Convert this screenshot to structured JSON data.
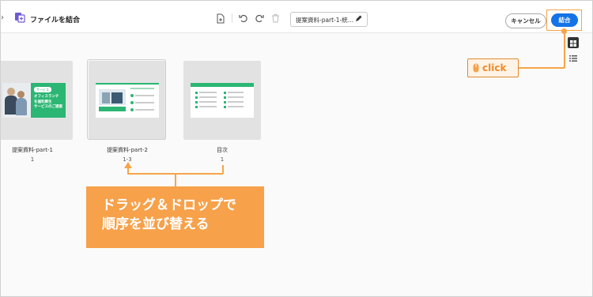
{
  "toolbar": {
    "title": "ファイルを結合",
    "filename": "提案資料-part-1-統…",
    "cancel_label": "キャンセル",
    "combine_label": "結合"
  },
  "icons": {
    "app": "combine-files-icon",
    "add_file": "add-file-icon",
    "undo": "undo-icon",
    "redo": "redo-icon",
    "delete": "delete-icon",
    "edit": "pencil-icon",
    "grid_view": "grid-view-icon",
    "list_view": "list-view-icon",
    "mouse": "mouse-icon"
  },
  "pages": [
    {
      "name": "提案資料-part-1",
      "range": "1",
      "slide": {
        "banner": "サービス",
        "lines": [
          "オフィスランチ",
          "を福利厚生",
          "サービスのご提案"
        ]
      }
    },
    {
      "name": "提案資料-part-2",
      "range": "1-3"
    },
    {
      "name": "目次",
      "range": "1"
    }
  ],
  "annotations": {
    "click_label": "click",
    "callout_lines": [
      "ドラッグ＆ドロップで",
      "順序を並び替える"
    ]
  },
  "colors": {
    "accent": "#1473e6",
    "annotation": "#f7a14a",
    "slide_green": "#2bb673"
  }
}
